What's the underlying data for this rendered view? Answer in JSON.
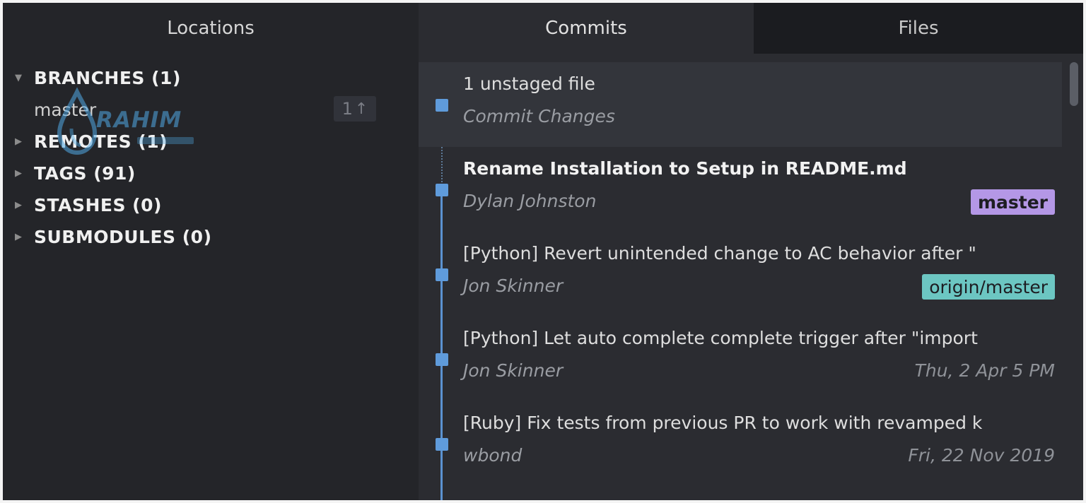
{
  "tabs": {
    "locations": "Locations",
    "commits": "Commits",
    "files": "Files"
  },
  "locations": {
    "branches_label": "BRANCHES (1)",
    "branch": {
      "name": "master",
      "ahead_count": "1",
      "ahead_icon": "arrow-up-icon"
    },
    "remotes_label": "REMOTES (1)",
    "tags_label": "TAGS (91)",
    "stashes_label": "STASHES (0)",
    "submodules_label": "SUBMODULES (0)"
  },
  "watermark": {
    "text": "RAHIM"
  },
  "commits": {
    "unstaged": {
      "title": "1 unstaged file",
      "subtitle": "Commit Changes"
    },
    "items": [
      {
        "title": "Rename Installation to Setup in README.md",
        "author": "Dylan Johnston",
        "ref": "master",
        "ref_color": "#b497e6"
      },
      {
        "title": "[Python] Revert unintended change to AC behavior after \"",
        "author": "Jon Skinner",
        "ref": "origin/master",
        "ref_color": "#6cc6c2"
      },
      {
        "title": "[Python] Let auto complete complete trigger after \"import",
        "author": "Jon Skinner",
        "date": "Thu, 2 Apr 5 PM"
      },
      {
        "title": "[Ruby] Fix tests from previous PR to work with revamped k",
        "author": "wbond",
        "date": "Fri, 22 Nov 2019"
      }
    ]
  },
  "colors": {
    "graph_node": "#5f9bdb",
    "panel_bg": "#242529",
    "commits_bg": "#2b2c31"
  }
}
